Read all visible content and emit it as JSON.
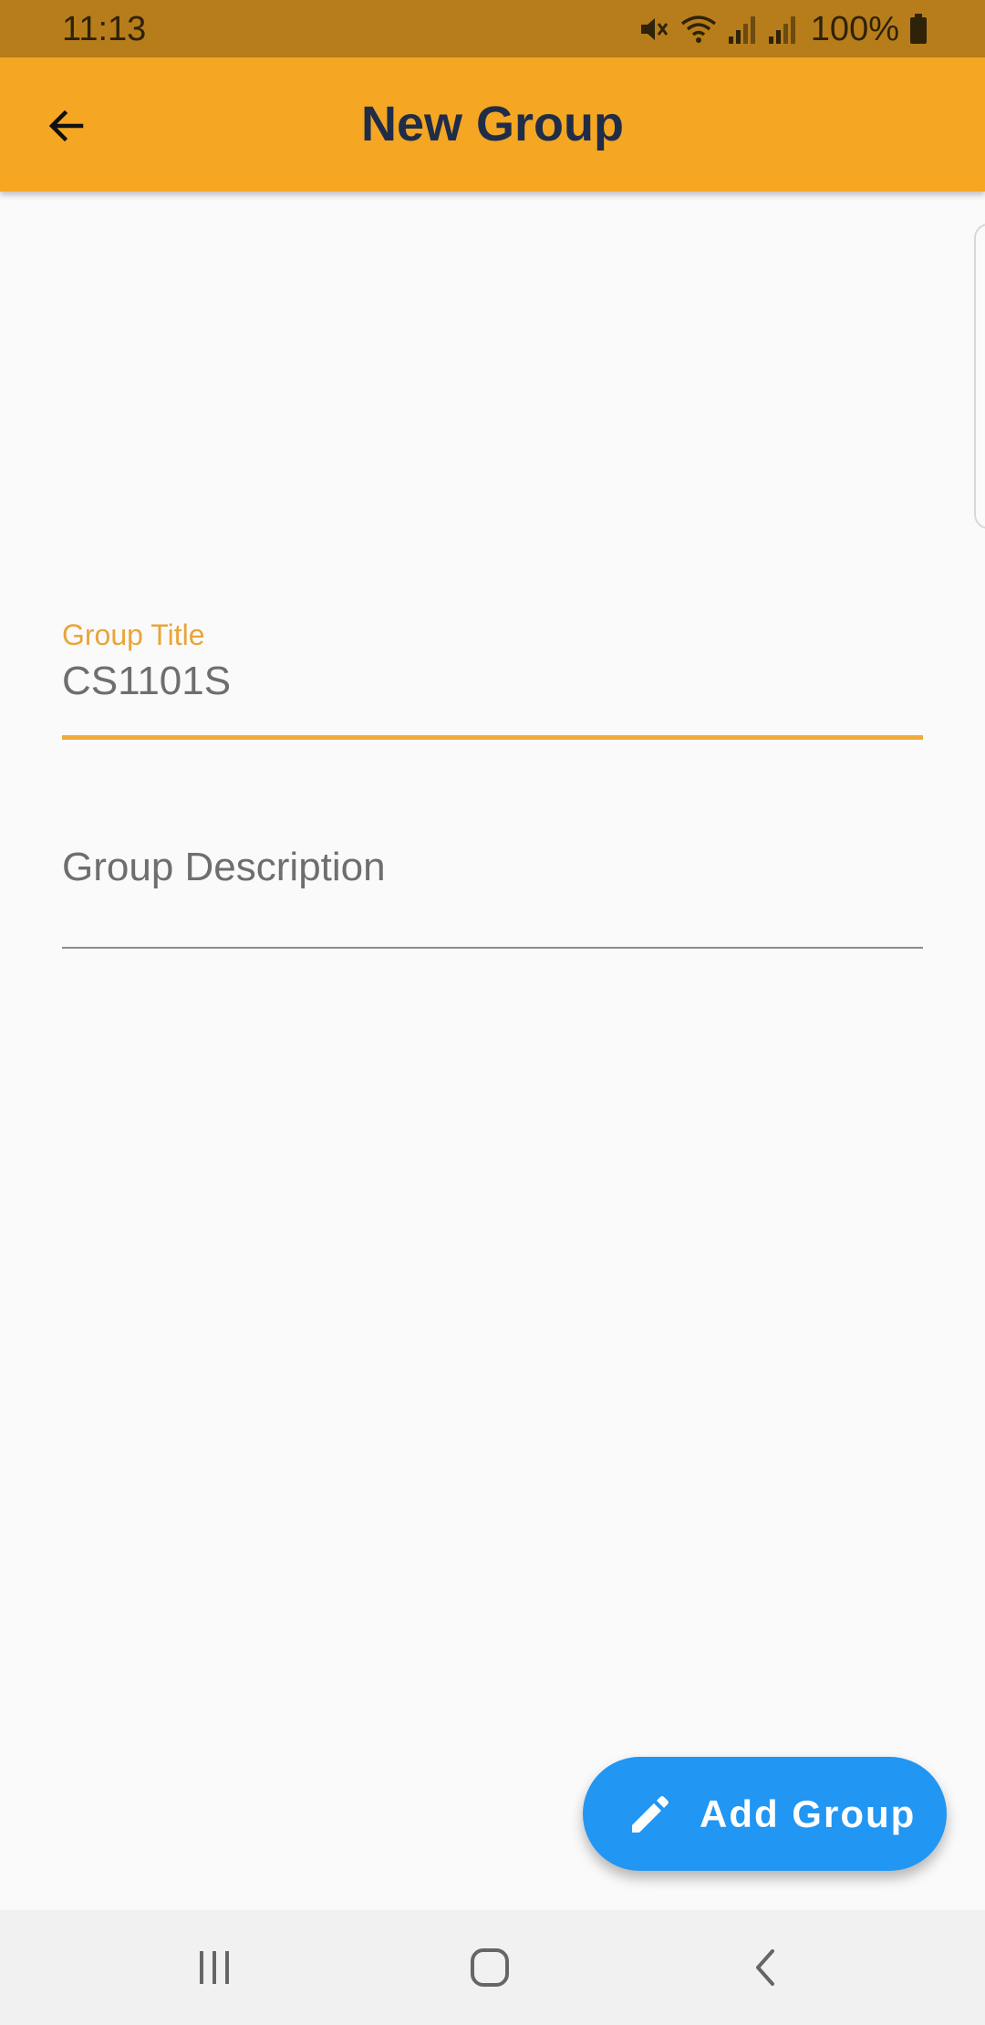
{
  "status_bar": {
    "time": "11:13",
    "battery": "100%",
    "icons": [
      "mute-icon",
      "wifi-icon",
      "signal-icon",
      "signal-icon",
      "battery-icon"
    ]
  },
  "app_bar": {
    "title": "New Group",
    "back_icon": "arrow-left-icon",
    "background_color": "#f5a623",
    "title_color": "#1f2d48"
  },
  "form": {
    "title_field": {
      "label": "Group Title",
      "value": "CS1101S",
      "accent_color": "#f0ab3c"
    },
    "description_field": {
      "placeholder": "Group Description",
      "value": ""
    }
  },
  "fab": {
    "label": "Add Group",
    "icon": "pencil-icon",
    "color": "#2196f3"
  },
  "nav_bar": {
    "buttons": [
      "recents-icon",
      "home-icon",
      "back-icon"
    ]
  }
}
